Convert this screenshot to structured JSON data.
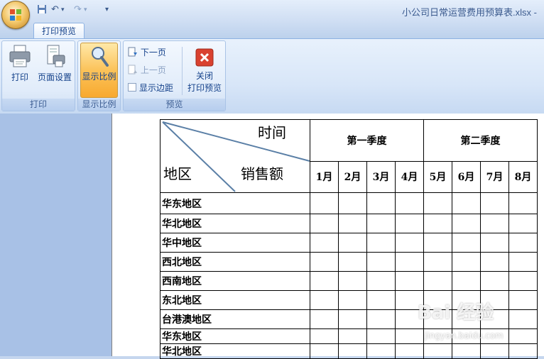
{
  "window": {
    "title": "小公司日常运营费用预算表.xlsx -"
  },
  "quick_access": {
    "icons": [
      "save-icon",
      "undo-icon",
      "redo-icon",
      "customize-icon"
    ]
  },
  "ribbon": {
    "tab": "打印预览",
    "groups": {
      "print": {
        "label": "打印",
        "print_btn": "打印",
        "page_setup_btn": "页面设置"
      },
      "zoom": {
        "label": "显示比例",
        "zoom_btn": "显示比例"
      },
      "preview": {
        "label": "预览",
        "next_page": "下一页",
        "prev_page": "上一页",
        "show_margins": "显示边距",
        "close_line1": "关闭",
        "close_line2": "打印预览"
      }
    }
  },
  "sheet": {
    "diag_top": "时间",
    "diag_mid": "销售额",
    "diag_left": "地区",
    "q1": "第一季度",
    "q2": "第二季度",
    "months": [
      "1月",
      "2月",
      "3月",
      "4月",
      "5月",
      "6月",
      "7月",
      "8月"
    ],
    "regions": [
      "华东地区",
      "华北地区",
      "华中地区",
      "西北地区",
      "西南地区",
      "东北地区",
      "台港澳地区",
      "华东地区",
      "华北地区"
    ]
  },
  "watermark": {
    "text": "Bai 经验",
    "sub": "jingyan.baidu.com"
  },
  "colors": {
    "ribbon_text": "#15428b",
    "active_button": "#fbc35a",
    "workspace": "#a8c1e6"
  }
}
